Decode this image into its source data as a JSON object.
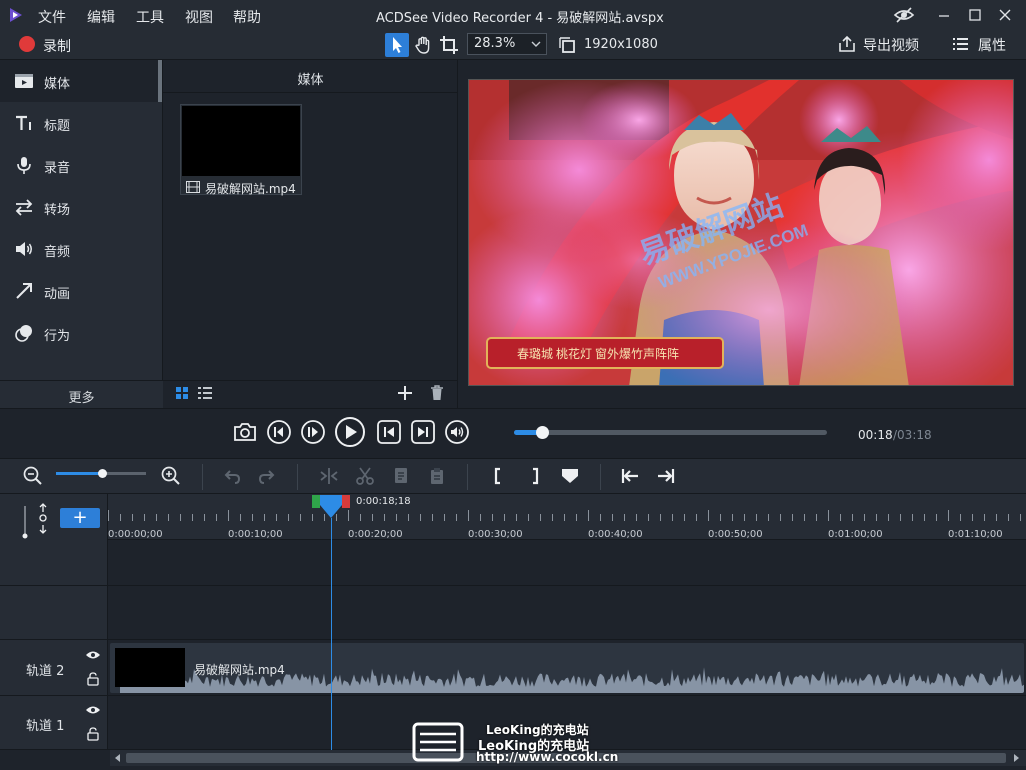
{
  "window": {
    "title": "ACDSee Video Recorder 4 - 易破解网站.avspx",
    "menu": [
      "文件",
      "编辑",
      "工具",
      "视图",
      "帮助"
    ]
  },
  "toolbar": {
    "record_label": "录制",
    "zoom_value": "28.3%",
    "resolution": "1920x1080",
    "export_label": "导出视频",
    "properties_label": "属性"
  },
  "categories": [
    {
      "label": "媒体",
      "icon": "media-icon"
    },
    {
      "label": "标题",
      "icon": "title-text-icon"
    },
    {
      "label": "录音",
      "icon": "microphone-icon"
    },
    {
      "label": "转场",
      "icon": "transition-icon"
    },
    {
      "label": "音频",
      "icon": "speaker-icon"
    },
    {
      "label": "动画",
      "icon": "arrow-animation-icon"
    },
    {
      "label": "行为",
      "icon": "behavior-icon"
    }
  ],
  "more_label": "更多",
  "media": {
    "header": "媒体",
    "item_name": "易破解网站.mp4"
  },
  "preview": {
    "watermark_cn": "易破解网站",
    "watermark_url": "WWW.YPOJIE.COM",
    "banner_text": "春璐城 桃花灯 窗外爆竹声阵阵"
  },
  "playback": {
    "time_current": "00:18",
    "time_total": "/03:18",
    "progress": 0.091
  },
  "timeline": {
    "playhead_time": "0:00:18;18",
    "ticks": [
      "0:00:00;00",
      "0:00:10;00",
      "0:00:20;00",
      "0:00:30;00",
      "0:00:40;00",
      "0:00:50;00",
      "0:01:00;00",
      "0:01:10;00"
    ],
    "tracks": [
      {
        "label": "轨道 2",
        "clip": "易破解网站.mp4"
      },
      {
        "label": "轨道 1"
      }
    ]
  },
  "watermark": {
    "line1": "LeoKing的充电站",
    "line2": "LeoKing的充电站",
    "line3": "http://www.cocokl.cn"
  },
  "colors": {
    "accent": "#2d8ce6",
    "record": "#e03a3a",
    "panel": "#262c35",
    "background": "#1e232b"
  }
}
